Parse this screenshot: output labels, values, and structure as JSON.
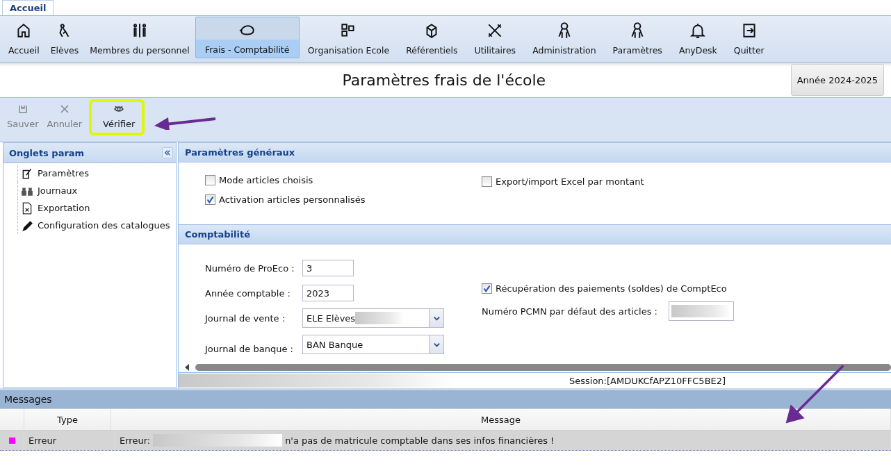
{
  "app_tabs": [
    {
      "label": "Accueil",
      "selected": true
    }
  ],
  "ribbon": [
    {
      "label": "Accueil",
      "selected": false
    },
    {
      "label": "Elèves",
      "selected": false
    },
    {
      "label": "Membres du personnel",
      "selected": false
    },
    {
      "label": "Frais - Comptabilité",
      "selected": true
    },
    {
      "label": "Organisation Ecole",
      "selected": false
    },
    {
      "label": "Référentiels",
      "selected": false
    },
    {
      "label": "Utilitaires",
      "selected": false
    },
    {
      "label": "Administration",
      "selected": false
    },
    {
      "label": "Paramètres",
      "selected": false
    },
    {
      "label": "AnyDesk",
      "selected": false
    },
    {
      "label": "Quitter",
      "selected": false
    }
  ],
  "page_title": "Paramètres frais de l'école",
  "year_button": "Année 2024-2025",
  "toolbar": [
    {
      "label": "Sauver",
      "disabled": true
    },
    {
      "label": "Annuler",
      "disabled": true
    },
    {
      "label": "Vérifier",
      "disabled": false
    }
  ],
  "side_panel": {
    "title": "Onglets param",
    "items": [
      {
        "label": "Paramètres"
      },
      {
        "label": "Journaux"
      },
      {
        "label": "Exportation"
      },
      {
        "label": "Configuration des catalogues"
      }
    ]
  },
  "general": {
    "title": "Paramètres généraux",
    "left_checks": [
      {
        "label": "Mode articles choisis",
        "checked": false
      },
      {
        "label": "Activation articles personnalisés",
        "checked": true
      }
    ],
    "right_checks": [
      {
        "label": "Export/import Excel par montant",
        "checked": false
      }
    ]
  },
  "accounting": {
    "title": "Comptabilité",
    "proeco": {
      "label": "Numéro de ProEco :",
      "value": "3"
    },
    "year": {
      "label": "Année comptable :",
      "value": "2023"
    },
    "sales_journal": {
      "label": "Journal de vente :",
      "value": "ELE Elèves"
    },
    "bank_journal": {
      "label": "Journal de banque :",
      "value": "BAN Banque"
    },
    "recovery": {
      "label": "Récupération des paiements (soldes) de ComptEco",
      "checked": true
    },
    "pcmn": {
      "label": "Numéro PCMN par défaut des articles :"
    }
  },
  "status_bar": {
    "session": "Session:[AMDUKCfAPZ10FFC5BE2]"
  },
  "messages": {
    "title": "Messages",
    "columns": [
      "Type",
      "Message"
    ],
    "rows": [
      {
        "color": "#ff00ff",
        "type": "Erreur",
        "prefix": "Erreur:",
        "message": "n'a pas de matricule comptable dans ses infos financières !"
      }
    ]
  }
}
